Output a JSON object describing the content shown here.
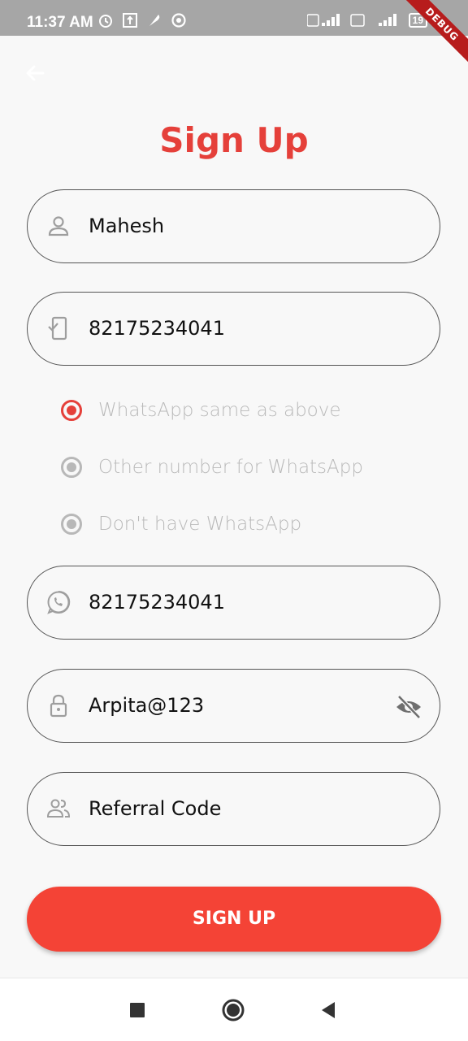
{
  "status_bar": {
    "time": "11:37 AM",
    "battery": "19",
    "debug_banner": "DEBUG"
  },
  "header": {
    "title": "Sign Up"
  },
  "form": {
    "name": {
      "value": "Mahesh",
      "icon": "person-icon"
    },
    "phone": {
      "value": "82175234041",
      "icon": "phone-verify-icon"
    },
    "whatsapp_options": [
      {
        "label": "WhatsApp same as above",
        "selected": true
      },
      {
        "label": "Other number for WhatsApp",
        "selected": false
      },
      {
        "label": "Don't have WhatsApp",
        "selected": false
      }
    ],
    "whatsapp": {
      "value": "82175234041",
      "icon": "whatsapp-icon"
    },
    "password": {
      "value": "Arpita@123",
      "icon": "lock-icon",
      "toggle_icon": "eye-off-icon"
    },
    "referral": {
      "placeholder": "Referral Code",
      "icon": "group-icon"
    }
  },
  "actions": {
    "signup_label": "SIGN UP"
  },
  "colors": {
    "accent": "#e5403a",
    "button": "#f44336",
    "status_bar": "#a6a6a6"
  }
}
